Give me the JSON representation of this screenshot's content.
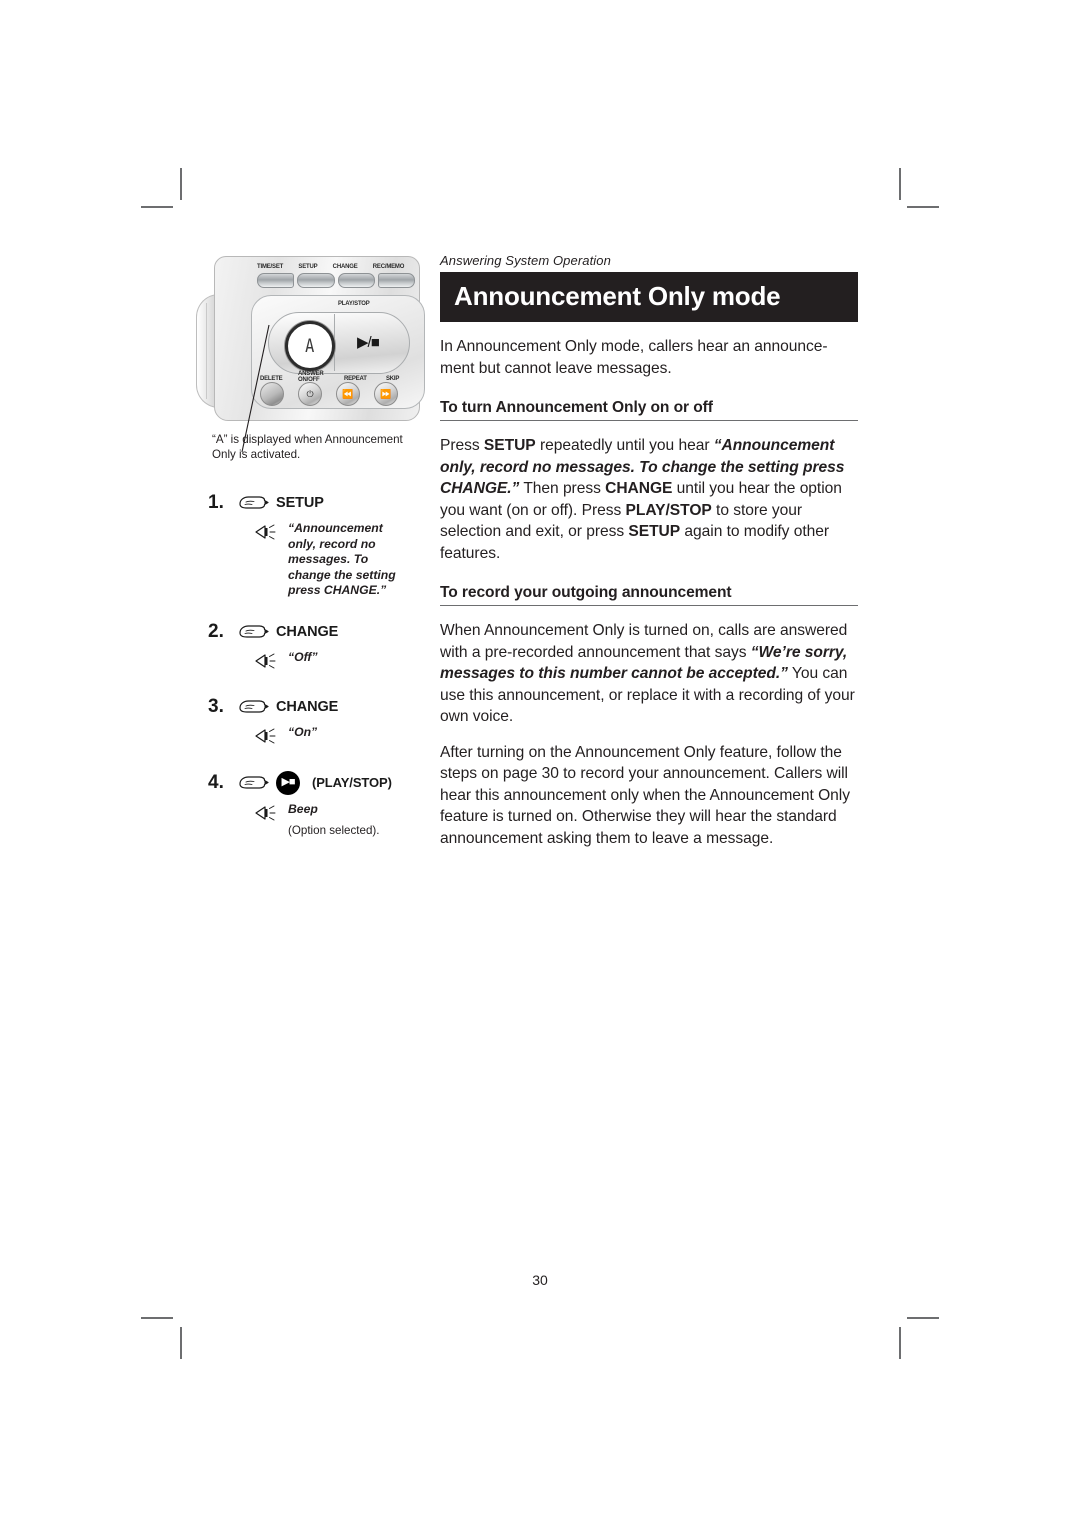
{
  "page": {
    "running_head": "Answering System Operation",
    "title": "Announcement Only mode",
    "folio": "30",
    "accent_dark": "#231f20",
    "rule_color": "#6d6e70"
  },
  "device": {
    "display_char": "A",
    "top_keys": [
      "TIME/SET",
      "SETUP",
      "CHANGE",
      "REC/MEMO"
    ],
    "playstop_label": "PLAY/STOP",
    "playstop_glyph": "▶/■",
    "bottom_keys": [
      {
        "label": "DELETE",
        "glyph": ""
      },
      {
        "label_line1": "ANSWER",
        "label_line2": "ON/OFF",
        "glyph": "⏻"
      },
      {
        "label": "REPEAT",
        "glyph": "⏪"
      },
      {
        "label": "SKIP",
        "glyph": "⏩"
      }
    ],
    "caption": "“A” is displayed when Announcement Only is activated."
  },
  "steps": [
    {
      "num": "1.",
      "key": "SETUP",
      "icon": "hand-pointer-icon",
      "audio": "“Announcement only, record no messages. To change the setting press CHANGE.”"
    },
    {
      "num": "2.",
      "key": "CHANGE",
      "icon": "hand-pointer-icon",
      "audio": "“Off”"
    },
    {
      "num": "3.",
      "key": "CHANGE",
      "icon": "hand-pointer-icon",
      "audio": "“On”"
    },
    {
      "num": "4.",
      "key": "(PLAY/STOP)",
      "icon": "hand-pointer-icon",
      "button_glyph": "▶■",
      "audio": "Beep",
      "audio_sub": "(Option selected)."
    }
  ],
  "content": {
    "intro": "In Announcement Only mode, callers hear an announce-ment but cannot leave messages.",
    "section1": {
      "heading": "To turn Announcement Only on or off",
      "p1_a": "Press ",
      "p1_b1": "SETUP",
      "p1_c": " repeatedly until you hear ",
      "p1_quote": "“Announcement only, record no messages. To change the setting press CHANGE.”",
      "p1_d": " Then press ",
      "p1_b2": "CHANGE",
      "p1_e": " until you hear the option you want (on or off). Press ",
      "p1_b3": "PLAY/STOP",
      "p1_f": " to store your selection and exit, or press ",
      "p1_b4": "SETUP",
      "p1_g": " again to modify other features."
    },
    "section2": {
      "heading": "To record your outgoing announcement",
      "p1_a": "When Announcement Only is turned on, calls are answered with a pre-recorded announcement that says ",
      "p1_quote": "“We’re sorry, messages to this number cannot be accepted.”",
      "p1_b": " You can use this announcement, or replace it with a recording of your own voice.",
      "p2": "After turning on the Announcement Only feature, follow the steps on page 30 to record your announcement. Callers will hear this announcement only when the Announcement Only feature is turned on. Otherwise they will hear the standard announcement asking them to leave a message."
    }
  }
}
